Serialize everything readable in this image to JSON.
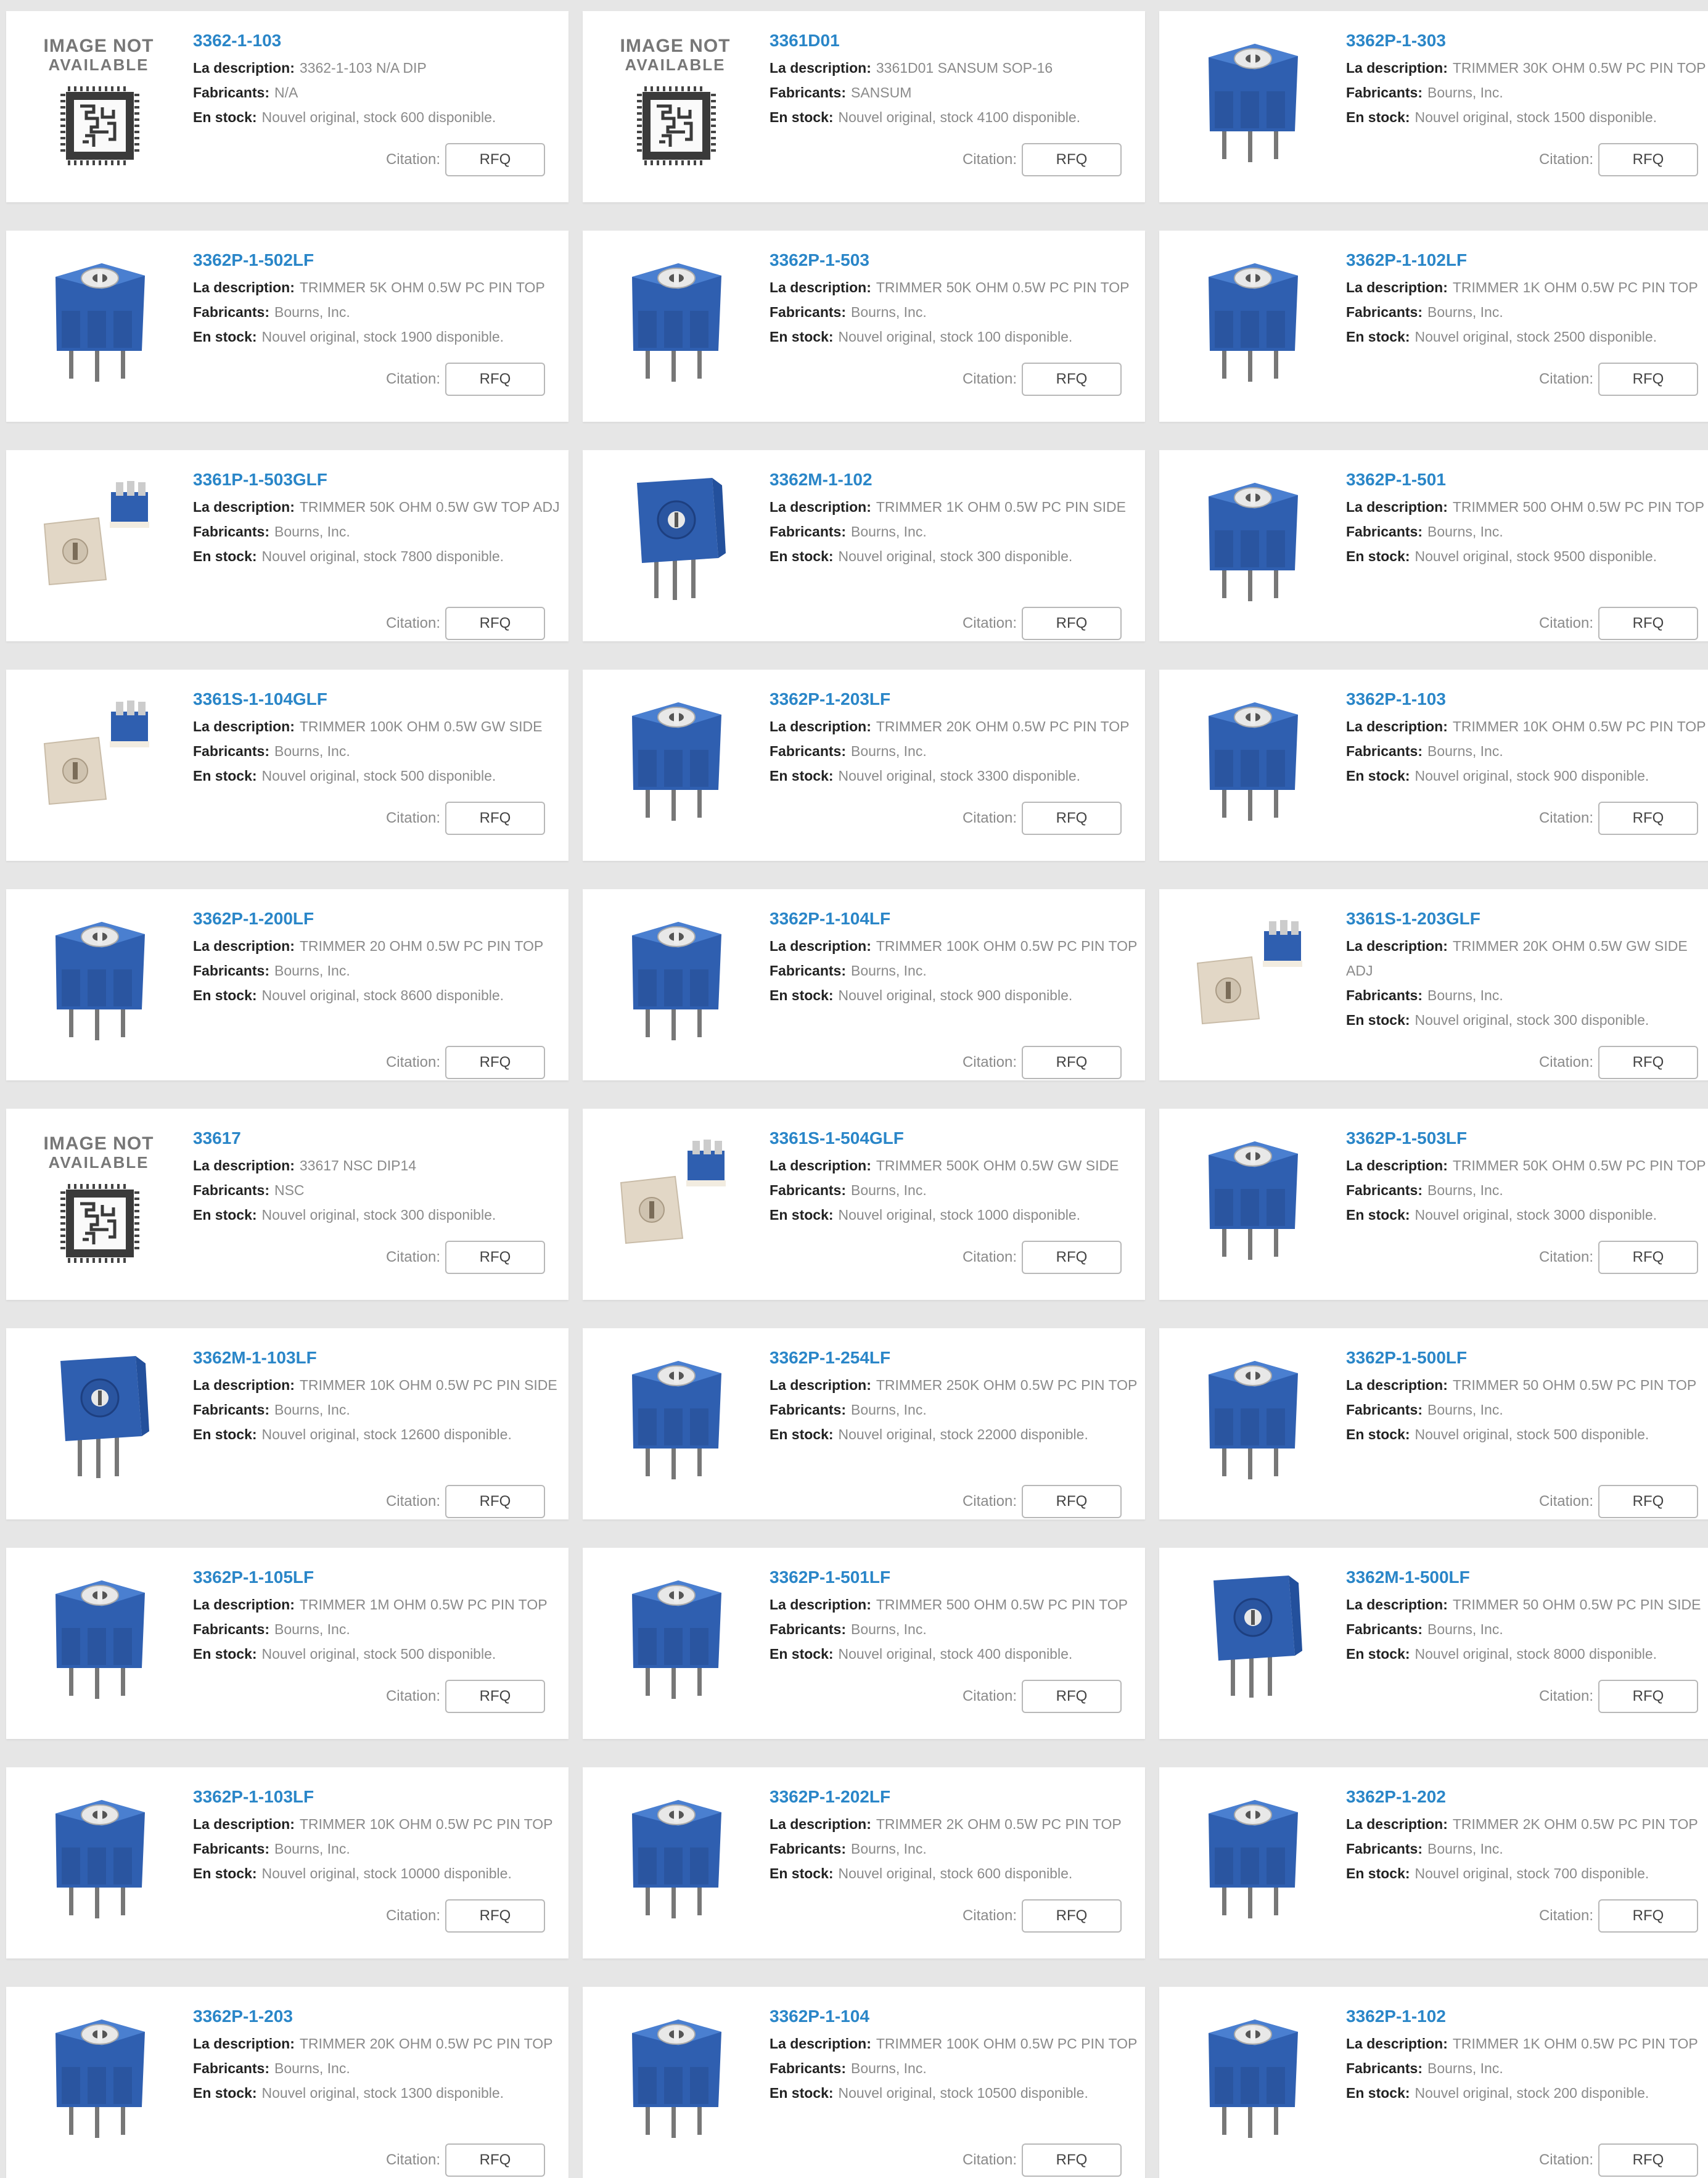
{
  "labels": {
    "description": "La description:",
    "manufacturer": "Fabricants:",
    "stock": "En stock:",
    "quote": "Citation:",
    "rfq": "RFQ"
  },
  "placeholder": {
    "line1": "IMAGE NOT",
    "line2": "AVAILABLE"
  },
  "colors": {
    "background": "#e6e6e6",
    "card": "#ffffff",
    "part_number": "#2a86c8",
    "component_blue": "#2f5fb0",
    "component_beige": "#e2d7c6"
  },
  "products": [
    {
      "pn": "3362-1-103",
      "desc": "3362-1-103 N/A DIP",
      "mfr": "N/A",
      "stock": "Nouvel original, stock 600 disponible.",
      "img": "none"
    },
    {
      "pn": "3361D01",
      "desc": "3361D01 SANSUM SOP-16",
      "mfr": "SANSUM",
      "stock": "Nouvel original, stock 4100 disponible.",
      "img": "none"
    },
    {
      "pn": "3362P-1-303",
      "desc": "TRIMMER 30K OHM 0.5W PC PIN TOP",
      "mfr": "Bourns, Inc.",
      "stock": "Nouvel original, stock 1500 disponible.",
      "img": "trimmer-top"
    },
    {
      "pn": "3362P-1-502LF",
      "desc": "TRIMMER 5K OHM 0.5W PC PIN TOP",
      "mfr": "Bourns, Inc.",
      "stock": "Nouvel original, stock 1900 disponible.",
      "img": "trimmer-top"
    },
    {
      "pn": "3362P-1-503",
      "desc": "TRIMMER 50K OHM 0.5W PC PIN TOP",
      "mfr": "Bourns, Inc.",
      "stock": "Nouvel original, stock 100 disponible.",
      "img": "trimmer-top"
    },
    {
      "pn": "3362P-1-102LF",
      "desc": "TRIMMER 1K OHM 0.5W PC PIN TOP",
      "mfr": "Bourns, Inc.",
      "stock": "Nouvel original, stock 2500 disponible.",
      "img": "trimmer-top"
    },
    {
      "pn": "3361P-1-503GLF",
      "desc": "TRIMMER 50K OHM 0.5W GW TOP ADJ",
      "mfr": "Bourns, Inc.",
      "stock": "Nouvel original, stock 7800 disponible.",
      "img": "smd"
    },
    {
      "pn": "3362M-1-102",
      "desc": "TRIMMER 1K OHM 0.5W PC PIN SIDE",
      "mfr": "Bourns, Inc.",
      "stock": "Nouvel original, stock 300 disponible.",
      "img": "trimmer-side"
    },
    {
      "pn": "3362P-1-501",
      "desc": "TRIMMER 500 OHM 0.5W PC PIN TOP",
      "mfr": "Bourns, Inc.",
      "stock": "Nouvel original, stock 9500 disponible.",
      "img": "trimmer-top"
    },
    {
      "pn": "3361S-1-104GLF",
      "desc": "TRIMMER 100K OHM 0.5W GW SIDE",
      "mfr": "Bourns, Inc.",
      "stock": "Nouvel original, stock 500 disponible.",
      "img": "smd"
    },
    {
      "pn": "3362P-1-203LF",
      "desc": "TRIMMER 20K OHM 0.5W PC PIN TOP",
      "mfr": "Bourns, Inc.",
      "stock": "Nouvel original, stock 3300 disponible.",
      "img": "trimmer-top"
    },
    {
      "pn": "3362P-1-103",
      "desc": "TRIMMER 10K OHM 0.5W PC PIN TOP",
      "mfr": "Bourns, Inc.",
      "stock": "Nouvel original, stock 900 disponible.",
      "img": "trimmer-top"
    },
    {
      "pn": "3362P-1-200LF",
      "desc": "TRIMMER 20 OHM 0.5W PC PIN TOP",
      "mfr": "Bourns, Inc.",
      "stock": "Nouvel original, stock 8600 disponible.",
      "img": "trimmer-top"
    },
    {
      "pn": "3362P-1-104LF",
      "desc": "TRIMMER 100K OHM 0.5W PC PIN TOP",
      "mfr": "Bourns, Inc.",
      "stock": "Nouvel original, stock 900 disponible.",
      "img": "trimmer-top"
    },
    {
      "pn": "3361S-1-203GLF",
      "desc": "TRIMMER 20K OHM 0.5W GW SIDE ADJ",
      "mfr": "Bourns, Inc.",
      "stock": "Nouvel original, stock 300 disponible.",
      "img": "smd"
    },
    {
      "pn": "33617",
      "desc": "33617 NSC DIP14",
      "mfr": "NSC",
      "stock": "Nouvel original, stock 300 disponible.",
      "img": "none"
    },
    {
      "pn": "3361S-1-504GLF",
      "desc": "TRIMMER 500K OHM 0.5W GW SIDE",
      "mfr": "Bourns, Inc.",
      "stock": "Nouvel original, stock 1000 disponible.",
      "img": "smd"
    },
    {
      "pn": "3362P-1-503LF",
      "desc": "TRIMMER 50K OHM 0.5W PC PIN TOP",
      "mfr": "Bourns, Inc.",
      "stock": "Nouvel original, stock 3000 disponible.",
      "img": "trimmer-top"
    },
    {
      "pn": "3362M-1-103LF",
      "desc": "TRIMMER 10K OHM 0.5W PC PIN SIDE",
      "mfr": "Bourns, Inc.",
      "stock": "Nouvel original, stock 12600 disponible.",
      "img": "trimmer-side"
    },
    {
      "pn": "3362P-1-254LF",
      "desc": "TRIMMER 250K OHM 0.5W PC PIN TOP",
      "mfr": "Bourns, Inc.",
      "stock": "Nouvel original, stock 22000 disponible.",
      "img": "trimmer-top"
    },
    {
      "pn": "3362P-1-500LF",
      "desc": "TRIMMER 50 OHM 0.5W PC PIN TOP",
      "mfr": "Bourns, Inc.",
      "stock": "Nouvel original, stock 500 disponible.",
      "img": "trimmer-top"
    },
    {
      "pn": "3362P-1-105LF",
      "desc": "TRIMMER 1M OHM 0.5W PC PIN TOP",
      "mfr": "Bourns, Inc.",
      "stock": "Nouvel original, stock 500 disponible.",
      "img": "trimmer-top"
    },
    {
      "pn": "3362P-1-501LF",
      "desc": "TRIMMER 500 OHM 0.5W PC PIN TOP",
      "mfr": "Bourns, Inc.",
      "stock": "Nouvel original, stock 400 disponible.",
      "img": "trimmer-top"
    },
    {
      "pn": "3362M-1-500LF",
      "desc": "TRIMMER 50 OHM 0.5W PC PIN SIDE",
      "mfr": "Bourns, Inc.",
      "stock": "Nouvel original, stock 8000 disponible.",
      "img": "trimmer-side"
    },
    {
      "pn": "3362P-1-103LF",
      "desc": "TRIMMER 10K OHM 0.5W PC PIN TOP",
      "mfr": "Bourns, Inc.",
      "stock": "Nouvel original, stock 10000 disponible.",
      "img": "trimmer-top"
    },
    {
      "pn": "3362P-1-202LF",
      "desc": "TRIMMER 2K OHM 0.5W PC PIN TOP",
      "mfr": "Bourns, Inc.",
      "stock": "Nouvel original, stock 600 disponible.",
      "img": "trimmer-top"
    },
    {
      "pn": "3362P-1-202",
      "desc": "TRIMMER 2K OHM 0.5W PC PIN TOP",
      "mfr": "Bourns, Inc.",
      "stock": "Nouvel original, stock 700 disponible.",
      "img": "trimmer-top"
    },
    {
      "pn": "3362P-1-203",
      "desc": "TRIMMER 20K OHM 0.5W PC PIN TOP",
      "mfr": "Bourns, Inc.",
      "stock": "Nouvel original, stock 1300 disponible.",
      "img": "trimmer-top"
    },
    {
      "pn": "3362P-1-104",
      "desc": "TRIMMER 100K OHM 0.5W PC PIN TOP",
      "mfr": "Bourns, Inc.",
      "stock": "Nouvel original, stock 10500 disponible.",
      "img": "trimmer-top"
    },
    {
      "pn": "3362P-1-102",
      "desc": "TRIMMER 1K OHM 0.5W PC PIN TOP",
      "mfr": "Bourns, Inc.",
      "stock": "Nouvel original, stock 200 disponible.",
      "img": "trimmer-top"
    }
  ]
}
